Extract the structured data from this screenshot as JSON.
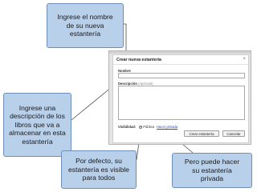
{
  "callouts": {
    "name_hint": [
      "Ingrese el  nombre",
      "de su nueva",
      "estantería"
    ],
    "description_hint": [
      "Ingrese  una",
      "descripción de los",
      "libros que va a",
      "almacenar en esta",
      "estantería"
    ],
    "visibility_default_hint": [
      "Por defecto, su",
      "estantería es visible",
      "para todos"
    ],
    "visibility_private_hint": [
      "Pero puede hacer",
      "su estantería",
      "privada"
    ]
  },
  "dialog": {
    "title": "Crear nueva estantería",
    "close_glyph": "×",
    "name_label": "Nombre",
    "name_value": "",
    "description_label": "Descripción",
    "description_optional": "(opcional)",
    "description_value": "",
    "visibility_label": "Visibilidad:",
    "visibility_public": "Pública",
    "visibility_private_link": "Hacer privada",
    "create_button": "Crear estantería",
    "cancel_button": "Cancelar"
  },
  "colors": {
    "callout_fill": "#b9d0ea",
    "callout_border": "#6d8fb7",
    "link": "#2747b8"
  }
}
